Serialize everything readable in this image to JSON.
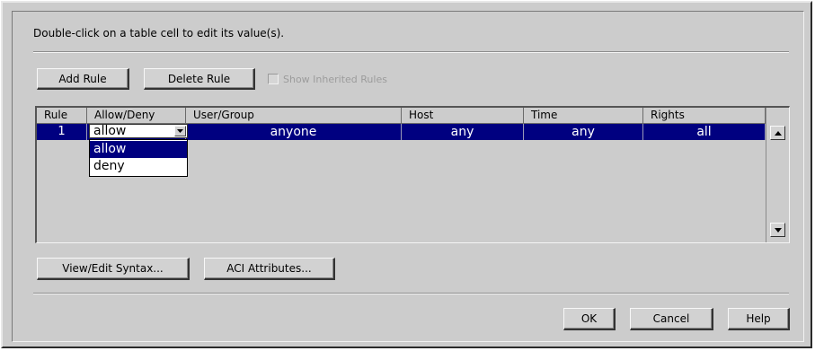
{
  "instruction": "Double-click on a table cell to edit its value(s).",
  "toolbar": {
    "add_rule": "Add Rule",
    "delete_rule": "Delete Rule",
    "show_inherited": "Show Inherited Rules"
  },
  "table": {
    "columns": [
      "Rule",
      "Allow/Deny",
      "User/Group",
      "Host",
      "Time",
      "Rights"
    ],
    "rows": [
      {
        "rule": "1",
        "allow_deny": "allow",
        "user_group": "anyone",
        "host": "any",
        "time": "any",
        "rights": "all"
      }
    ],
    "dropdown_options": [
      "allow",
      "deny"
    ],
    "dropdown_selected": "allow"
  },
  "buttons": {
    "view_edit_syntax": "View/Edit Syntax...",
    "aci_attributes": "ACI Attributes...",
    "ok": "OK",
    "cancel": "Cancel",
    "help": "Help"
  },
  "icons": {
    "combo_arrow": "chevron-down-icon",
    "scroll_up": "arrow-up-icon",
    "scroll_down": "arrow-down-icon"
  },
  "colors": {
    "selection": "#000080",
    "dialog_bg": "#cccccc"
  }
}
